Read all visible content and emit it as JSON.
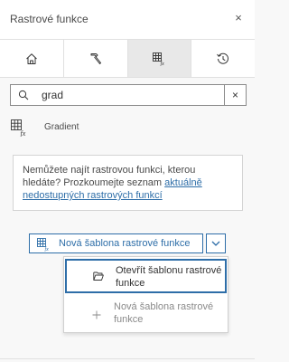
{
  "header": {
    "title": "Rastrové funkce",
    "close_glyph": "×"
  },
  "tabs": [
    {
      "icon": "home-icon",
      "active": false
    },
    {
      "icon": "hammer-icon",
      "active": false
    },
    {
      "icon": "raster-function-icon",
      "active": true
    },
    {
      "icon": "history-icon",
      "active": false
    }
  ],
  "search": {
    "value": "grad",
    "clear_glyph": "×"
  },
  "results": [
    {
      "icon": "raster-function-icon",
      "label": "Gradient"
    }
  ],
  "notice": {
    "text": "Nemůžete najít rastrovou funkci, kterou hledáte? Prozkoumejte seznam ",
    "link": "aktuálně nedostupných rastrových funkcí"
  },
  "template_button": {
    "label": "Nová šablona rastrové funkce",
    "icon": "raster-function-icon"
  },
  "dropdown": {
    "items": [
      {
        "label": "Otevřít šablonu rastrové funkce",
        "icon": "folder-open-icon",
        "selected": true
      },
      {
        "label": "Nová šablona rastrové funkce",
        "icon": "plus-icon",
        "selected": false
      }
    ]
  },
  "colors": {
    "accent": "#2e6ea8",
    "active_tab": "#e8e8e8",
    "text": "#4a4a4a",
    "muted": "#8a8a8a"
  }
}
